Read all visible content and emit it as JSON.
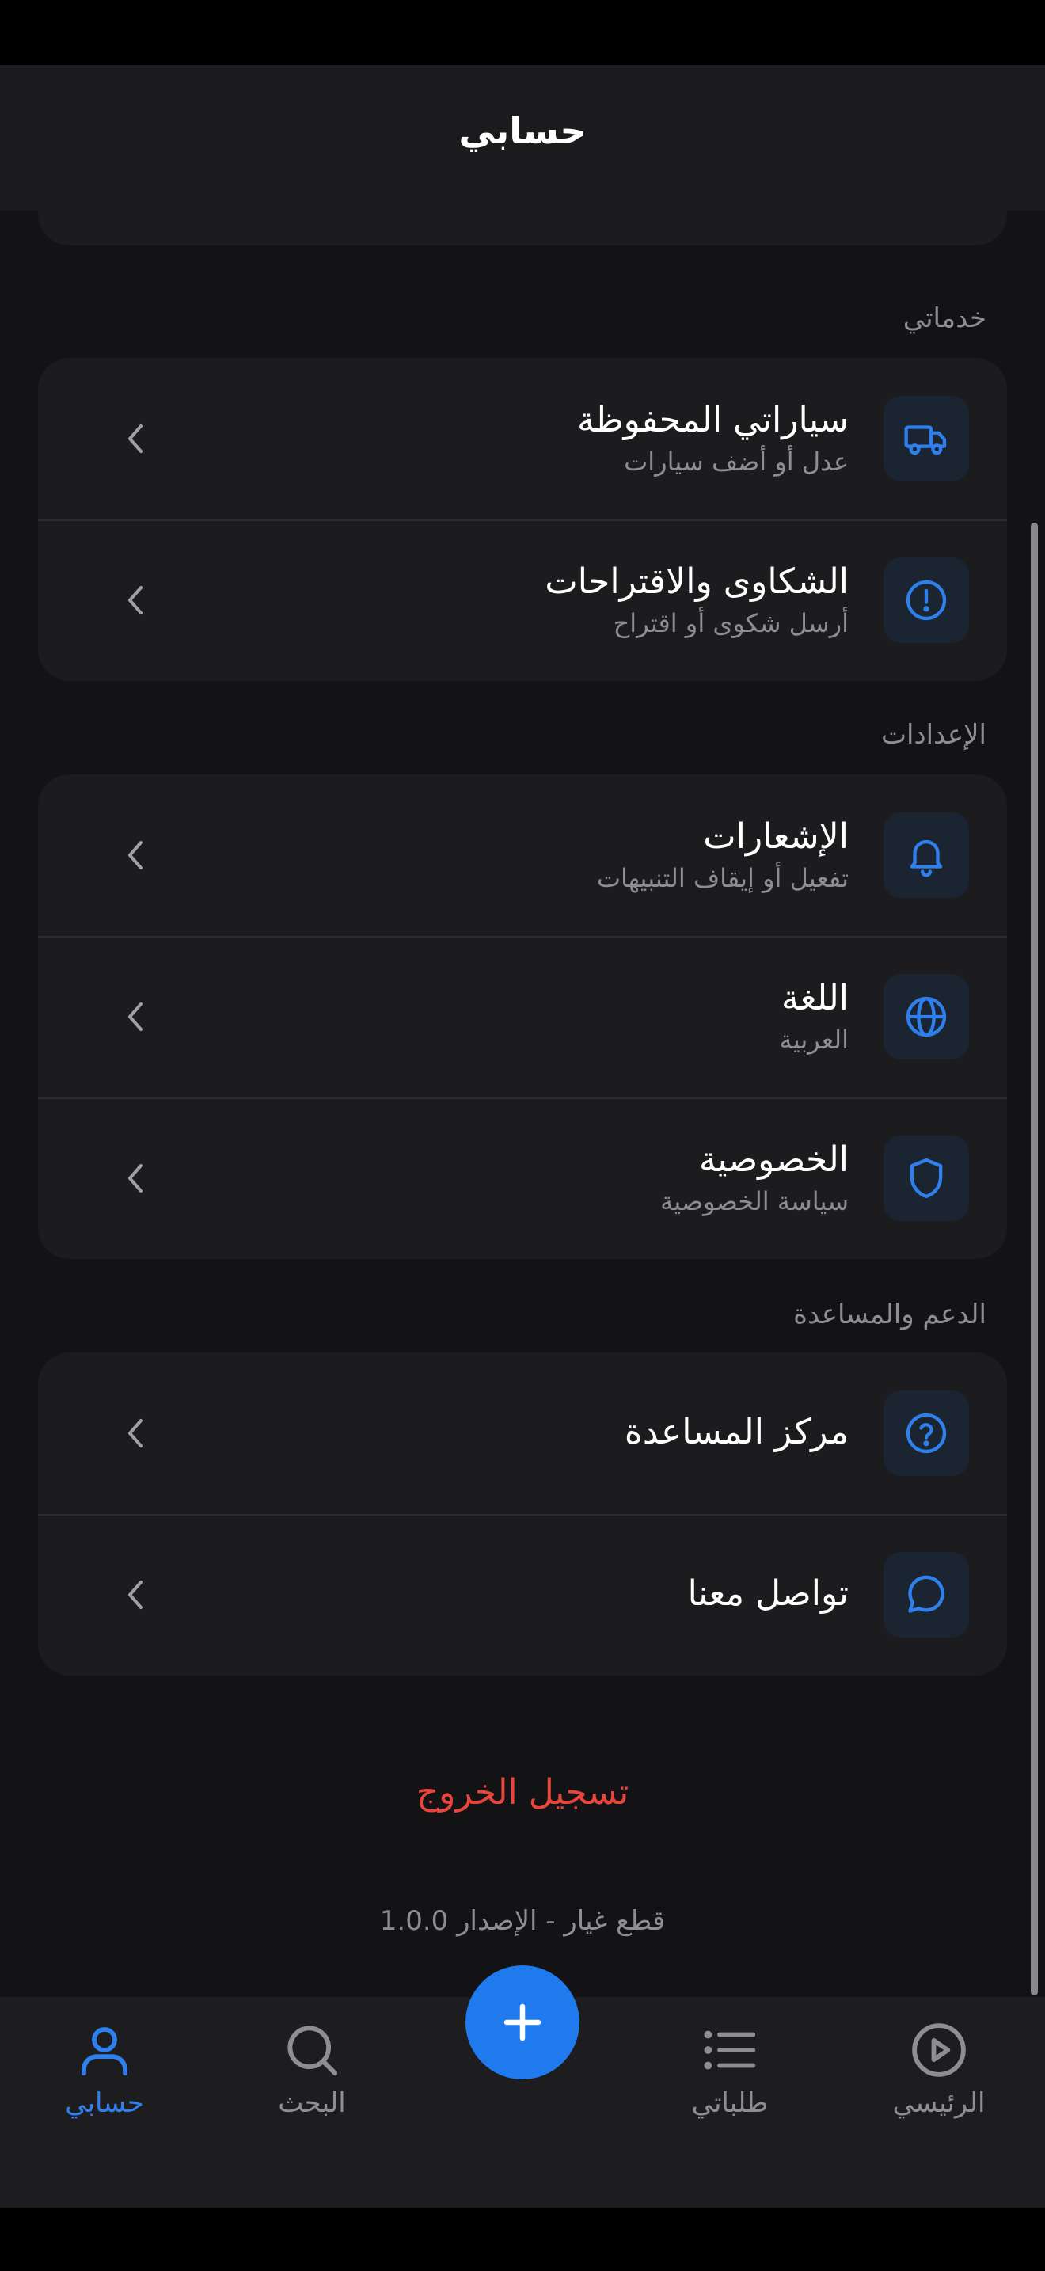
{
  "header": {
    "title": "حسابي"
  },
  "sections": [
    {
      "label": "خدماتي",
      "items": [
        {
          "title": "سياراتي المحفوظة",
          "subtitle": "عدل أو أضف سيارات",
          "icon": "truck-icon"
        },
        {
          "title": "الشكاوى والاقتراحات",
          "subtitle": "أرسل شكوى أو اقتراح",
          "icon": "alert-circle-icon"
        }
      ]
    },
    {
      "label": "الإعدادات",
      "items": [
        {
          "title": "الإشعارات",
          "subtitle": "تفعيل أو إيقاف التنبيهات",
          "icon": "bell-icon"
        },
        {
          "title": "اللغة",
          "subtitle": "العربية",
          "icon": "globe-icon"
        },
        {
          "title": "الخصوصية",
          "subtitle": "سياسة الخصوصية",
          "icon": "shield-icon"
        }
      ]
    },
    {
      "label": "الدعم والمساعدة",
      "items": [
        {
          "title": "مركز المساعدة",
          "icon": "help-circle-icon"
        },
        {
          "title": "تواصل معنا",
          "icon": "message-circle-icon"
        }
      ]
    }
  ],
  "logout": {
    "label": "تسجيل الخروج"
  },
  "footer": {
    "version": "قطع غيار - الإصدار 1.0.0"
  },
  "tabbar": {
    "tabs": [
      {
        "label": "حسابي",
        "icon": "user-icon",
        "active": true
      },
      {
        "label": "البحث",
        "icon": "search-icon",
        "active": false
      },
      {
        "label": "طلباتي",
        "icon": "list-icon",
        "active": false
      },
      {
        "label": "الرئيسي",
        "icon": "play-circle-icon",
        "active": false
      }
    ],
    "fab_icon": "plus-icon"
  },
  "colors": {
    "accent": "#2f80ed",
    "danger": "#e8453c",
    "background": "#131315",
    "card": "#1c1c1f",
    "muted_text": "#8d8d92"
  }
}
